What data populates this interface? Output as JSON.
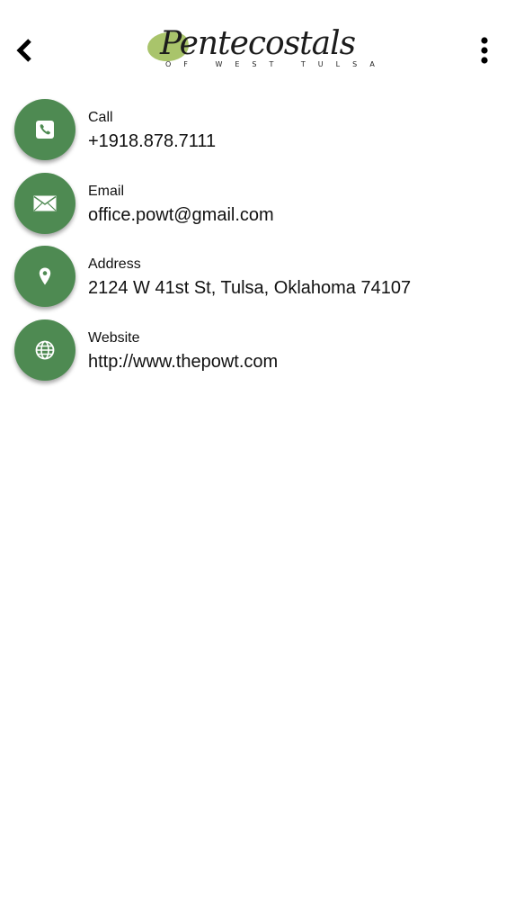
{
  "header": {
    "logo_title": "Pentecostals",
    "logo_subtitle": "OF WEST TULSA",
    "back_icon": "chevron-left-icon",
    "menu_icon": "more-vertical-icon"
  },
  "colors": {
    "accent": "#4e8a52",
    "logo_blob": "#a9c46b",
    "background": "#ffffff",
    "text": "#111111"
  },
  "contacts": [
    {
      "icon": "phone-icon",
      "label": "Call",
      "value": "+1918.878.7111"
    },
    {
      "icon": "mail-icon",
      "label": "Email",
      "value": "office.powt@gmail.com"
    },
    {
      "icon": "map-pin-icon",
      "label": "Address",
      "value": "2124 W 41st St, Tulsa, Oklahoma 74107"
    },
    {
      "icon": "globe-icon",
      "label": "Website",
      "value": "http://www.thepowt.com"
    }
  ]
}
